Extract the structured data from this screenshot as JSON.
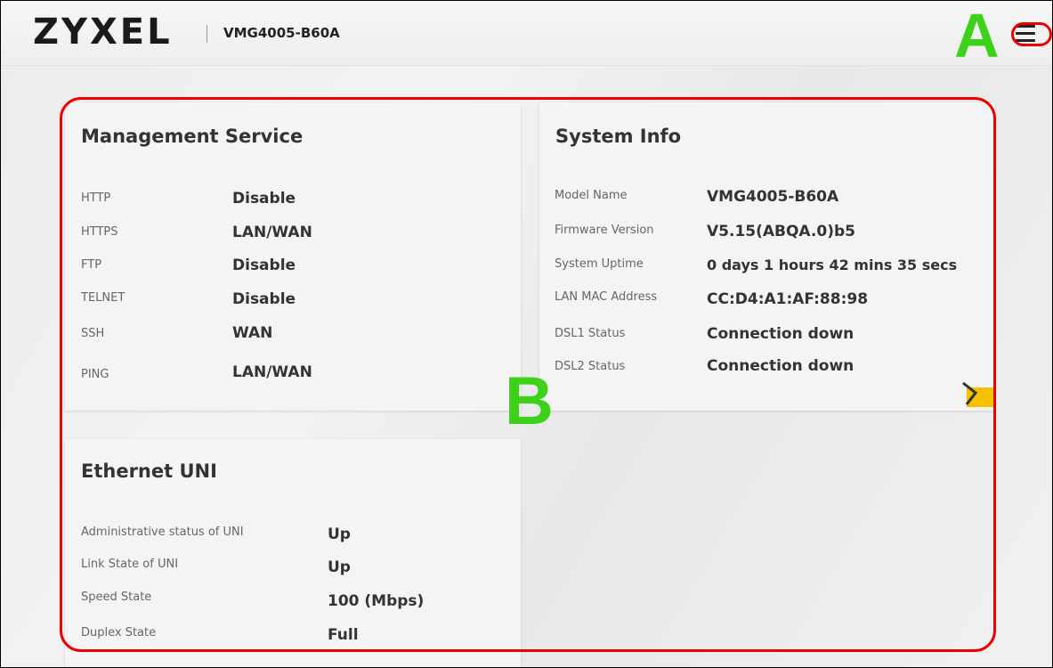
{
  "header": {
    "brand": "ZYXEL",
    "model": "VMG4005-B60A"
  },
  "callouts": {
    "a": "A",
    "b": "B"
  },
  "management": {
    "title": "Management Service",
    "rows": [
      {
        "label": "HTTP",
        "value": "Disable"
      },
      {
        "label": "HTTPS",
        "value": "LAN/WAN"
      },
      {
        "label": "FTP",
        "value": "Disable"
      },
      {
        "label": "TELNET",
        "value": "Disable"
      },
      {
        "label": "SSH",
        "value": "WAN"
      },
      {
        "label": "PING",
        "value": "LAN/WAN"
      }
    ]
  },
  "system": {
    "title": "System Info",
    "rows": [
      {
        "label": "Model Name",
        "value": "VMG4005-B60A"
      },
      {
        "label": "Firmware Version",
        "value": "V5.15(ABQA.0)b5"
      },
      {
        "label": "System Uptime",
        "value": "0 days 1 hours 42 mins 35 secs"
      },
      {
        "label": "LAN MAC Address",
        "value": "CC:D4:A1:AF:88:98"
      },
      {
        "label": "DSL1 Status",
        "value": "Connection down"
      },
      {
        "label": "DSL2 Status",
        "value": "Connection down"
      }
    ]
  },
  "ethernet": {
    "title": "Ethernet UNI",
    "rows": [
      {
        "label": "Administrative status of UNI",
        "value": "Up"
      },
      {
        "label": "Link State of UNI",
        "value": "Up"
      },
      {
        "label": "Speed State",
        "value": "100 (Mbps)"
      },
      {
        "label": "Duplex State",
        "value": "Full"
      }
    ]
  },
  "icons": {
    "menu": "hamburger-menu-icon",
    "next": "chevron-right-icon"
  },
  "colors": {
    "callout": "#3dd11a",
    "highlight": "#ee0000",
    "accent": "#f6c000"
  }
}
